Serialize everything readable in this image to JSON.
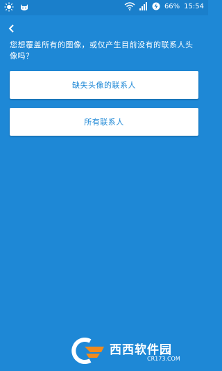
{
  "status_bar": {
    "battery": "66%",
    "time": "15:54",
    "colors": {
      "bar": "#1a7fcb"
    }
  },
  "back_icon": "chevron-left-icon",
  "prompt": "您想覆盖所有的图像，或仅产生目前没有的联系人头像吗？",
  "options": [
    {
      "label": "缺失头像的联系人"
    },
    {
      "label": "所有联系人"
    }
  ],
  "watermark": {
    "brand": "西西软件园",
    "url": "CR173.COM"
  },
  "colors": {
    "background": "#1e88d6",
    "button_bg": "#ffffff",
    "button_text": "#1e88d6"
  }
}
